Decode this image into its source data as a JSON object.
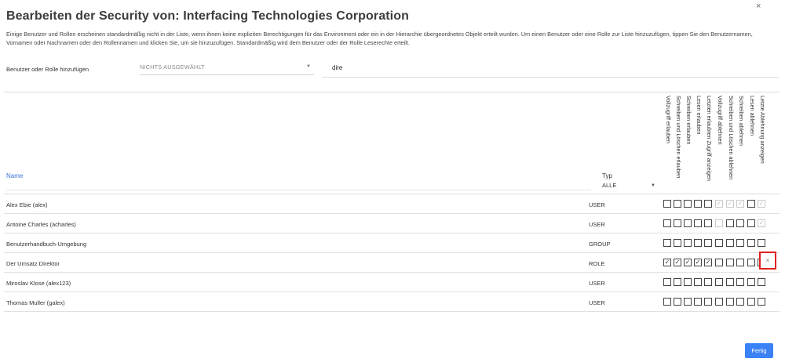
{
  "dialog": {
    "title": "Bearbeiten der Security von: Interfacing Technologies Corporation",
    "description": "Einige Benutzer und Rollen erscheinen standardmäßig nicht in der Liste, wenn ihnen keine expliziten Berechtigungen für das Environment oder ein in der Hierarchie übergeordnetes Objekt erteilt wurden. Um einen Benutzer oder eine Rolle zur Liste hinzuzufügen, tippen Sie den Benutzernamen, Vornamen oder Nachnamen oder den Rollennamen und klicken Sie, um sie hinzuzufügen. Standardmäßig wird dem Benutzer oder der Rolle Leserechte erteilt.",
    "close_glyph": "×",
    "done_label": "Fertig"
  },
  "add": {
    "label": "Benutzer oder Rolle hinzufügen",
    "select_value": "NICHTS AUSGEWÄHLT",
    "search_value": "dire"
  },
  "table": {
    "name_header": "Name",
    "type_header": "Typ",
    "type_filter": "ALLE",
    "perm_headers": [
      "Vollzugriff erlauben",
      "Schreiben und Löschen erlauben",
      "Schreiben erlauben",
      "Lesen erlauben",
      "Letzten erlaubten Zugriff anzeigen",
      "Vollzugriff ablehnen",
      "Schreiben und Löschen ablehnen",
      "Schreiben ablehnen",
      "Lesen ablehnen",
      "Letzte Ablehnung anzeigen"
    ],
    "rows": [
      {
        "name": "Alex Ebie (alex)",
        "type": "USER",
        "perms": [
          "off",
          "off",
          "off",
          "off",
          "off",
          "dis-on",
          "dis-on",
          "dis-on",
          "off",
          "dis-on"
        ]
      },
      {
        "name": "Antoine Charles (acharles)",
        "type": "USER",
        "perms": [
          "off",
          "off",
          "off",
          "off",
          "off",
          "dis-off",
          "off",
          "off",
          "off",
          "dis-on"
        ]
      },
      {
        "name": "Benutzerhandbuch-Umgebung",
        "type": "GROUP",
        "perms": [
          "off",
          "off",
          "off",
          "off",
          "off",
          "off",
          "off",
          "off",
          "off",
          "off"
        ]
      },
      {
        "name": "Der Umsatz Direktor",
        "type": "ROLE",
        "perms": [
          "on",
          "on",
          "on",
          "on",
          "on",
          "off",
          "off",
          "off",
          "off",
          "off"
        ]
      },
      {
        "name": "Miroslav  Klose (alex123)",
        "type": "USER",
        "perms": [
          "off",
          "off",
          "off",
          "off",
          "off",
          "off",
          "off",
          "off",
          "off",
          "off"
        ]
      },
      {
        "name": "Thomas Muller (galex)",
        "type": "USER",
        "perms": [
          "off",
          "off",
          "off",
          "off",
          "off",
          "off",
          "off",
          "off",
          "off",
          "off"
        ]
      }
    ],
    "remove_glyph": "×"
  }
}
